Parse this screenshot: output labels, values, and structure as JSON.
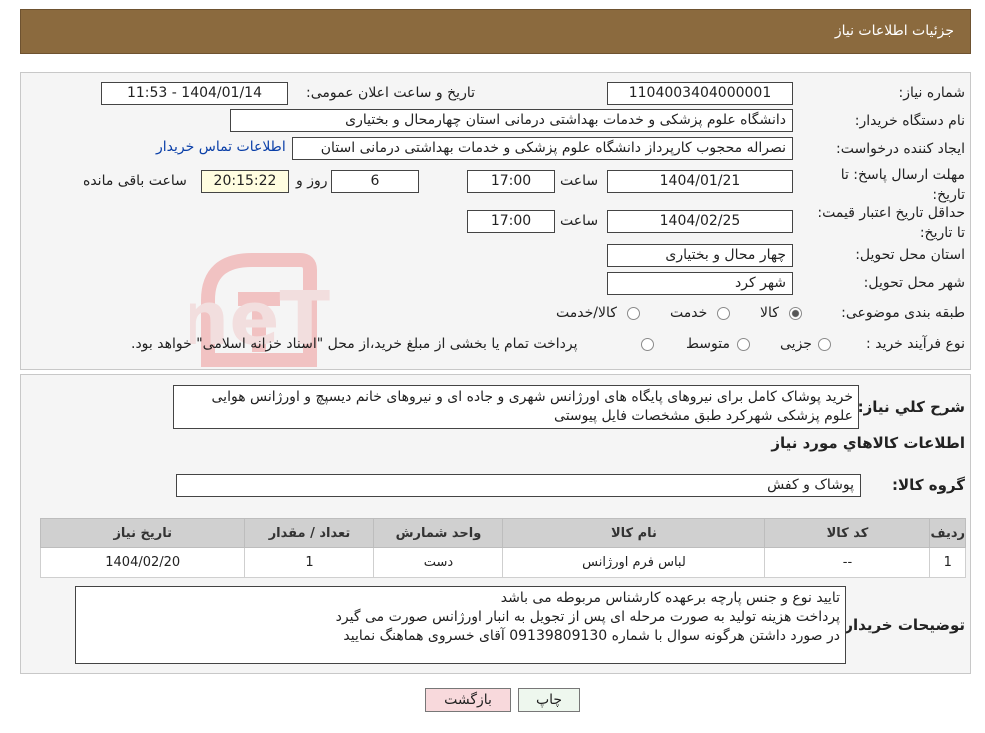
{
  "header": {
    "title": "جزئیات اطلاعات نیاز"
  },
  "details": {
    "need_number_label": "شماره نیاز:",
    "need_number": "1104003404000001",
    "announce_label": "تاریخ و ساعت اعلان عمومی:",
    "announce_value": "1404/01/14 - 11:53",
    "buyer_org_label": "نام دستگاه خریدار:",
    "buyer_org": "دانشگاه علوم پزشکی و خدمات بهداشتی درمانی استان چهارمحال و بختیاری",
    "creator_label": "ایجاد کننده درخواست:",
    "creator": "نصراله محجوب کارپرداز دانشگاه علوم پزشکی و خدمات بهداشتی درمانی استان",
    "contact_link": "اطلاعات تماس خریدار",
    "deadline_label": "مهلت ارسال پاسخ: تا تاریخ:",
    "deadline_date": "1404/01/21",
    "time_label": "ساعت",
    "deadline_time": "17:00",
    "days_value": "6",
    "days_label": "روز و",
    "remaining_time": "20:15:22",
    "remaining_label": "ساعت باقی مانده",
    "validity_label": "حداقل تاریخ اعتبار قیمت: تا تاریخ:",
    "validity_date": "1404/02/25",
    "validity_time_label": "ساعت",
    "validity_time": "17:00",
    "province_label": "استان محل تحویل:",
    "province": "چهار محال و بختیاری",
    "city_label": "شهر محل تحویل:",
    "city": "شهر کرد",
    "category_label": "طبقه بندی موضوعی:",
    "category_options": [
      "کالا",
      "خدمت",
      "کالا/خدمت"
    ],
    "category_selected": "کالا",
    "process_label": "نوع فرآیند خرید :",
    "process_options": [
      "جزیی",
      "متوسط"
    ],
    "process_selected": "",
    "payment_note": "پرداخت تمام یا بخشی از مبلغ خرید،از محل \"اسناد خزانه اسلامی\" خواهد بود."
  },
  "summary": {
    "label": "شرح کلي نياز:",
    "text": "خرید پوشاک کامل برای نیروهای پایگاه های اورژانس شهری و جاده ای و نیروهای خانم دیسپچ و اورژانس هوایی علوم پزشکی شهرکرد طبق مشخصات فایل پیوستی",
    "goods_info_title": "اطلاعات کالاهاي مورد نياز",
    "group_label": "گروه کالا:",
    "group_value": "پوشاک و کفش"
  },
  "table": {
    "headers": [
      "رديف",
      "کد کالا",
      "نام کالا",
      "واحد شمارش",
      "تعداد / مقدار",
      "تاریخ نیاز"
    ],
    "rows": [
      [
        "1",
        "--",
        "لباس فرم اورژانس",
        "دست",
        "1",
        "1404/02/20"
      ]
    ]
  },
  "buyer_notes": {
    "label": "توضیحات خریدار:",
    "lines": [
      "تایید نوع و جنس پارچه برعهده کارشناس مربوطه می باشد",
      "پرداخت هزینه تولید به صورت مرحله ای پس از تجویل به انبار اورژانس صورت می گیرد",
      "در صورد داشتن هرگونه سوال با شماره 09139809130 آقای خسروی هماهنگ نمایید"
    ]
  },
  "buttons": {
    "print": "چاپ",
    "back": "بازگشت"
  },
  "watermark": {
    "text": "AriaTender.neT"
  },
  "colors": {
    "header_bg": "#8b6a3e",
    "link": "#0a3fa8",
    "back_button_bg": "#f8d9dc",
    "time_box_bg": "#fffde0"
  }
}
